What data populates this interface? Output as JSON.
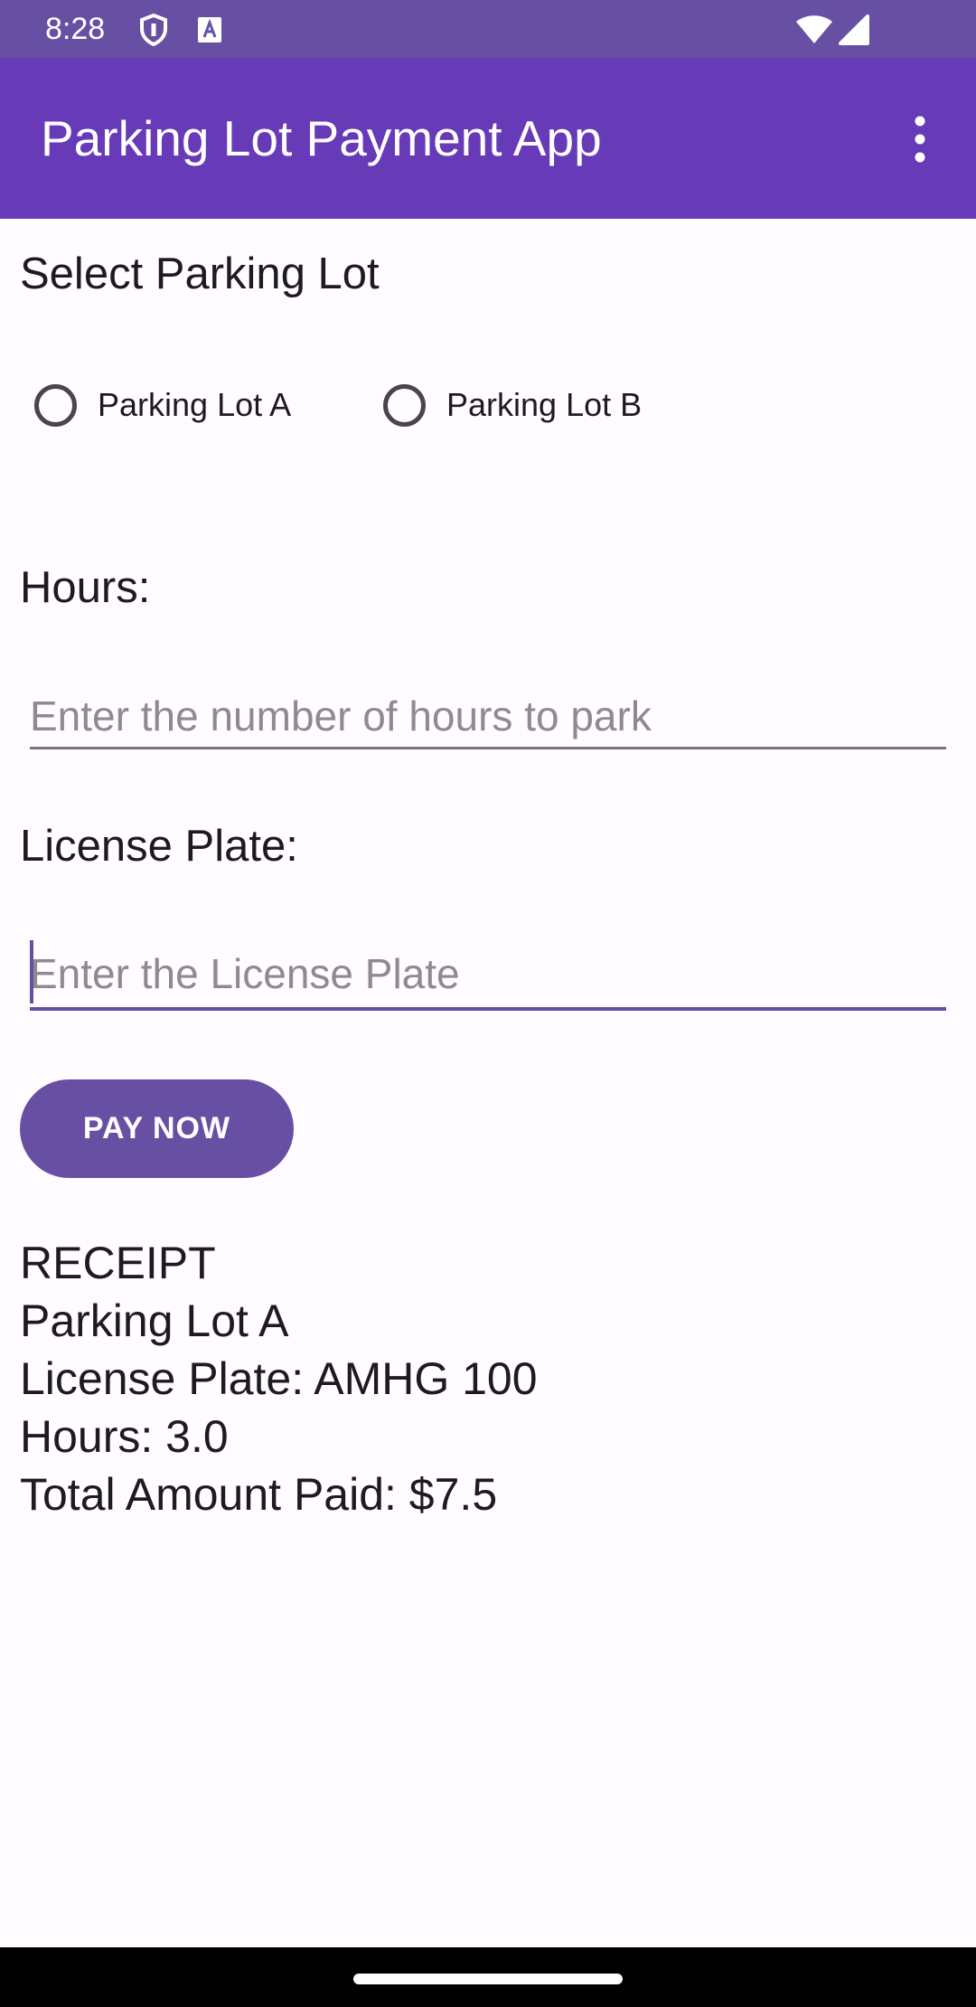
{
  "status_bar": {
    "time": "8:28",
    "icons": [
      "shield-icon",
      "font-a-icon",
      "wifi-icon",
      "signal-icon"
    ],
    "color": "#6750a4"
  },
  "app_bar": {
    "title": "Parking Lot Payment App",
    "overflow_icon": "more-vertical-icon",
    "color": "#673ab7"
  },
  "form": {
    "select_lot_title": "Select Parking Lot",
    "lots": [
      {
        "label": "Parking Lot A",
        "selected": false
      },
      {
        "label": "Parking Lot B",
        "selected": false
      }
    ],
    "hours_label": "Hours:",
    "hours_value": "",
    "hours_placeholder": "Enter the number of hours to park",
    "plate_label": "License Plate:",
    "plate_value": "",
    "plate_placeholder": "Enter the License Plate",
    "pay_button": "PAY NOW"
  },
  "receipt": {
    "heading": "RECEIPT",
    "lot": "Parking Lot A",
    "plate": "License Plate: AMHG 100",
    "hours": "Hours: 3.0",
    "total": "Total Amount Paid: $7.5"
  },
  "colors": {
    "accent": "#6750a4",
    "background": "#fffbfe"
  }
}
